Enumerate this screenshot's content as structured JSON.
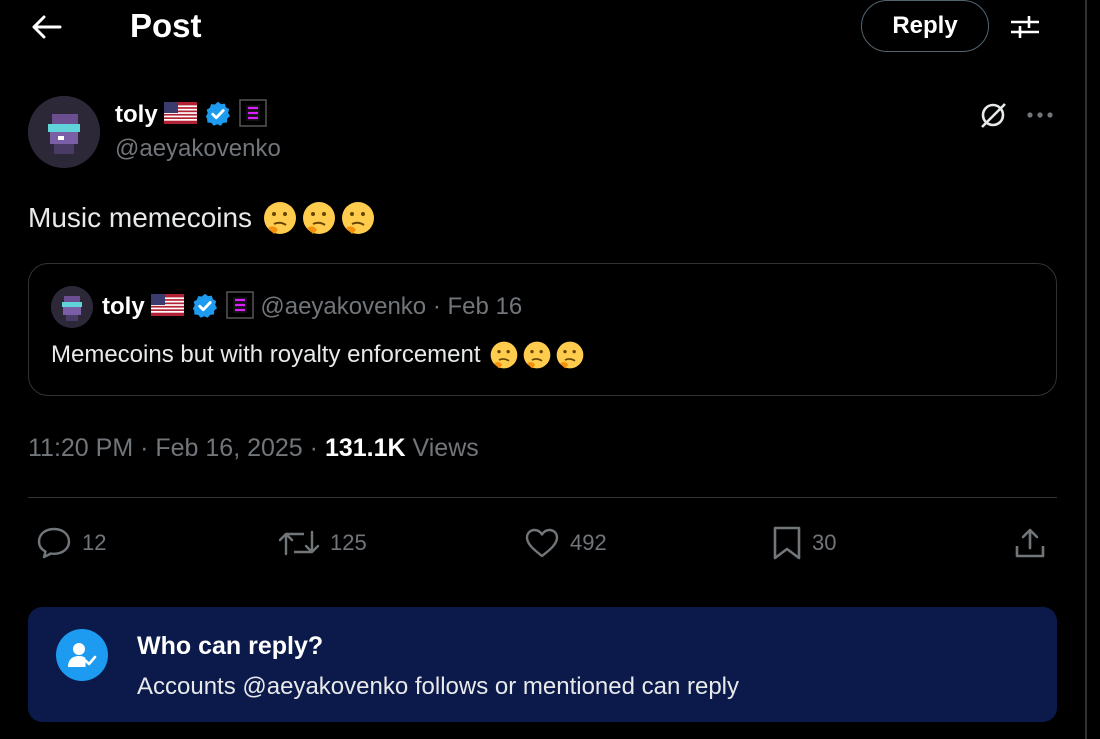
{
  "header": {
    "title": "Post",
    "reply_label": "Reply",
    "back_icon": "arrow-left-icon",
    "filter_icon": "sliders-icon"
  },
  "post": {
    "author_name": "toly",
    "author_handle": "@aeyakovenko",
    "flag": "us-flag",
    "verified_icon": "verified-badge-icon",
    "text": "Music memecoins",
    "emoji": "🤔🤔🤔",
    "timestamp": "11:20 PM · Feb 16, 2025 · ",
    "views_count": "131.1K",
    "views_label": " Views"
  },
  "quote": {
    "author_name": "toly",
    "meta": "@aeyakovenko · Feb 16",
    "text": "Memecoins but with royalty enforcement",
    "emoji": "🤔🤔🤔"
  },
  "actions": {
    "replies": "12",
    "reposts": "125",
    "likes": "492",
    "bookmarks": "30"
  },
  "who_can_reply": {
    "title": "Who can reply?",
    "description": "Accounts @aeyakovenko follows or mentioned can reply"
  },
  "colors": {
    "accent": "#1d9bf0",
    "muted": "#71767b",
    "card_bg": "#0b1a4a"
  }
}
